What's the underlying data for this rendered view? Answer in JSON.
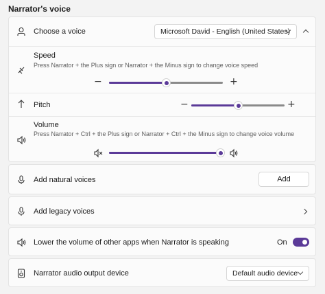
{
  "section": {
    "title": "Narrator's voice"
  },
  "voice": {
    "label": "Choose a voice",
    "selected": "Microsoft David - English (United States)",
    "icon": "person-icon"
  },
  "speed": {
    "label": "Speed",
    "description": "Press Narrator + the Plus sign or Narrator + the Minus sign to change voice speed",
    "value_fraction": 0.5,
    "decrease": "−",
    "increase": "+",
    "icon": "speed-icon"
  },
  "pitch": {
    "label": "Pitch",
    "value_fraction": 0.5,
    "decrease": "−",
    "increase": "+",
    "icon": "arrow-up-icon"
  },
  "volume": {
    "label": "Volume",
    "description": "Press Narrator + Ctrl + the Plus sign or Narrator + Ctrl + the Minus sign to change voice volume",
    "value_fraction": 1.0,
    "icon": "speaker-icon"
  },
  "natural_voices": {
    "label": "Add natural voices",
    "button": "Add",
    "icon": "microphone-icon"
  },
  "legacy_voices": {
    "label": "Add legacy voices",
    "icon": "microphone-icon"
  },
  "lower_volume": {
    "label": "Lower the volume of other apps when Narrator is speaking",
    "state": "On",
    "icon": "speaker-icon"
  },
  "output_device": {
    "label": "Narrator audio output device",
    "selected": "Default audio device",
    "icon": "speaker-device-icon"
  },
  "colors": {
    "accent": "#5b3a98",
    "track": "#8a8a8a"
  }
}
